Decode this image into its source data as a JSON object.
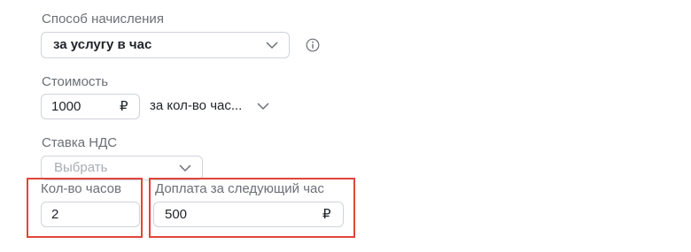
{
  "accrual": {
    "label": "Способ начисления",
    "value": "за услугу в час"
  },
  "cost": {
    "label": "Стоимость",
    "value": "1000",
    "currency": "₽",
    "unit_select": "за кол-во час..."
  },
  "vat": {
    "label": "Ставка НДС",
    "placeholder": "Выбрать"
  },
  "hours": {
    "label": "Кол-во часов",
    "value": "2"
  },
  "extra": {
    "label": "Доплата за следующий час",
    "value": "500",
    "currency": "₽"
  },
  "icons": {
    "chevron": "chevron-down-icon",
    "info": "info-icon"
  },
  "colors": {
    "highlight": "#e0453b",
    "border": "#cfd3da",
    "label": "#6b6f76"
  }
}
